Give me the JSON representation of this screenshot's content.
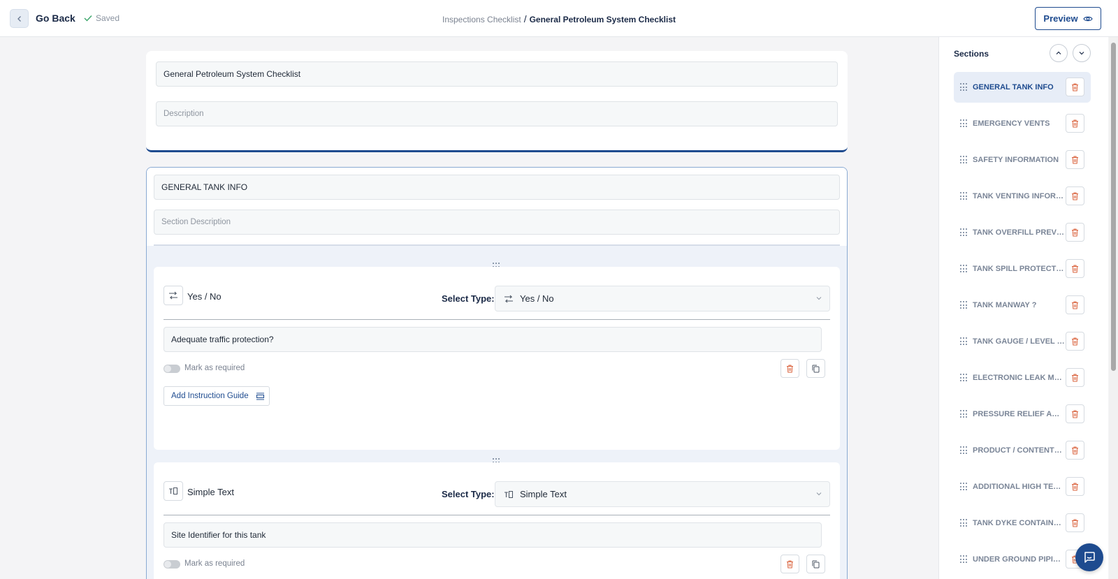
{
  "topbar": {
    "go_back_label": "Go Back",
    "saved_label": "Saved",
    "breadcrumb_parent": "Inspections Checklist",
    "breadcrumb_separator": "/",
    "breadcrumb_current": "General Petroleum System Checklist",
    "preview_label": "Preview"
  },
  "checklist": {
    "title_value": "General Petroleum System Checklist",
    "description_placeholder": "Description"
  },
  "section": {
    "title_value": "GENERAL TANK INFO",
    "description_placeholder": "Section Description",
    "questions": [
      {
        "type_label": "Yes / No",
        "select_type_label": "Select Type:",
        "select_value": "Yes / No",
        "question_text": "Adequate traffic protection?",
        "required_label": "Mark as required",
        "guide_label": "Add Instruction Guide"
      },
      {
        "type_label": "Simple Text",
        "select_type_label": "Select Type:",
        "select_value": "Simple Text",
        "question_text": "Site Identifier for this tank",
        "required_label": "Mark as required"
      }
    ]
  },
  "sidebar": {
    "title": "Sections",
    "items": [
      {
        "label": "GENERAL TANK INFO"
      },
      {
        "label": "EMERGENCY VENTS"
      },
      {
        "label": "SAFETY INFORMATION"
      },
      {
        "label": "TANK VENTING INFORMATION"
      },
      {
        "label": "TANK OVERFILL PREVENTION"
      },
      {
        "label": "TANK SPILL PROTECTION INFO"
      },
      {
        "label": "TANK MANWAY ?"
      },
      {
        "label": "TANK GAUGE / LEVEL MONITOR"
      },
      {
        "label": "ELECTRONIC LEAK MONITOR"
      },
      {
        "label": "PRESSURE RELIEF AG PIPING"
      },
      {
        "label": "PRODUCT / CONTENTS CHECK"
      },
      {
        "label": "ADDITIONAL HIGH TECHNOLOGY"
      },
      {
        "label": "TANK DYKE CONTAINMENT"
      },
      {
        "label": "UNDER GROUND PIPING ?"
      }
    ]
  },
  "colors": {
    "accent": "#1e4b8f",
    "delete_icon": "#d9603a",
    "background": "#f4f4f6"
  }
}
